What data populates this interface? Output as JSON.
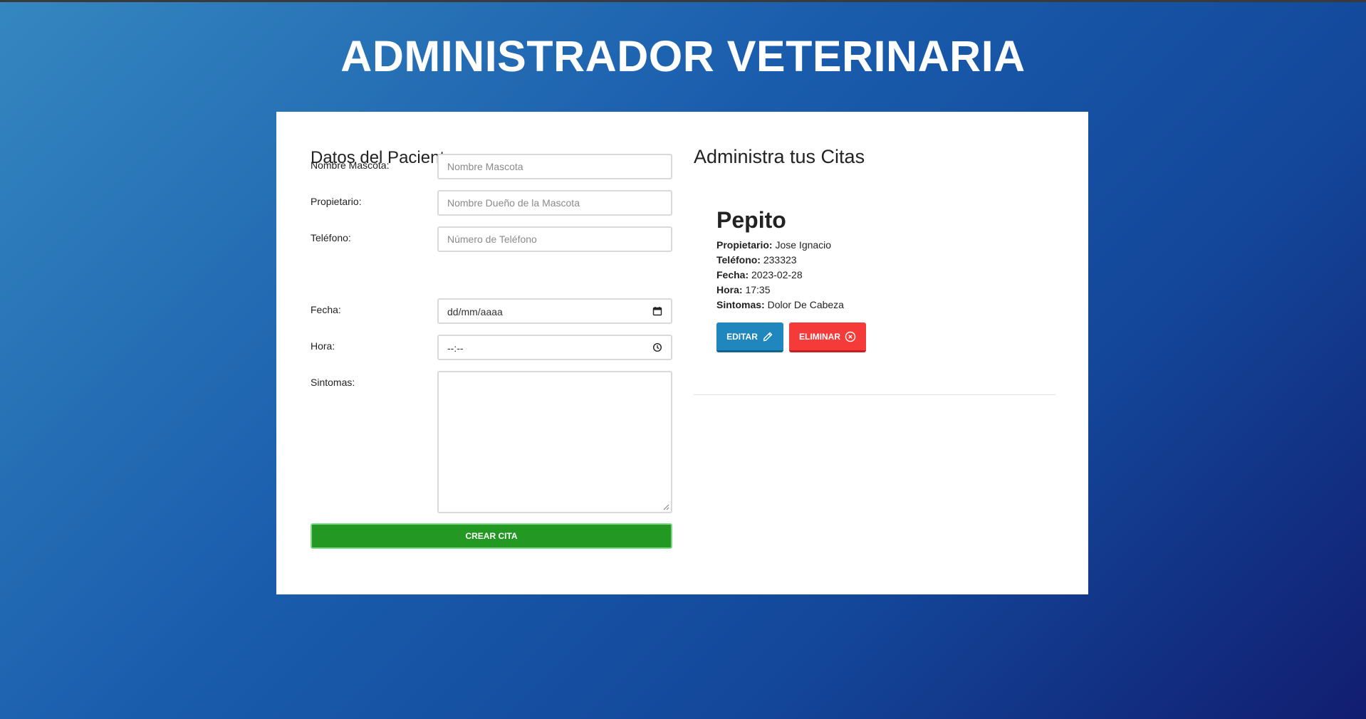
{
  "header": {
    "title": "ADMINISTRADOR VETERINARIA"
  },
  "form": {
    "heading": "Datos del Paciente",
    "fields": [
      {
        "label": "Nombre Mascota:",
        "placeholder": "Nombre Mascota",
        "value": ""
      },
      {
        "label": "Propietario:",
        "placeholder": "Nombre Dueño de la Mascota",
        "value": ""
      },
      {
        "label": "Teléfono:",
        "placeholder": "Número de Teléfono",
        "value": ""
      },
      {
        "label": "Fecha:",
        "display": "dd/mm/aaaa",
        "icon": "calendar-icon"
      },
      {
        "label": "Hora:",
        "display": "--:--",
        "icon": "clock-icon"
      },
      {
        "label": "Sintomas:",
        "value": ""
      }
    ],
    "submit_label": "CREAR CITA"
  },
  "appointments": {
    "heading": "Administra tus Citas",
    "items": [
      {
        "pet": "Pepito",
        "owner_label": "Propietario:",
        "owner": "Jose Ignacio",
        "phone_label": "Teléfono:",
        "phone": "233323",
        "date_label": "Fecha:",
        "date": "2023-02-28",
        "time_label": "Hora:",
        "time": "17:35",
        "symptoms_label": "Sintomas:",
        "symptoms": "Dolor De Cabeza",
        "edit_label": "EDITAR",
        "delete_label": "ELIMINAR"
      }
    ]
  },
  "colors": {
    "submit": "#239822",
    "edit": "#1f87bd",
    "delete": "#f53a3a",
    "background_start": "#3587c0",
    "background_end": "#121d70"
  }
}
